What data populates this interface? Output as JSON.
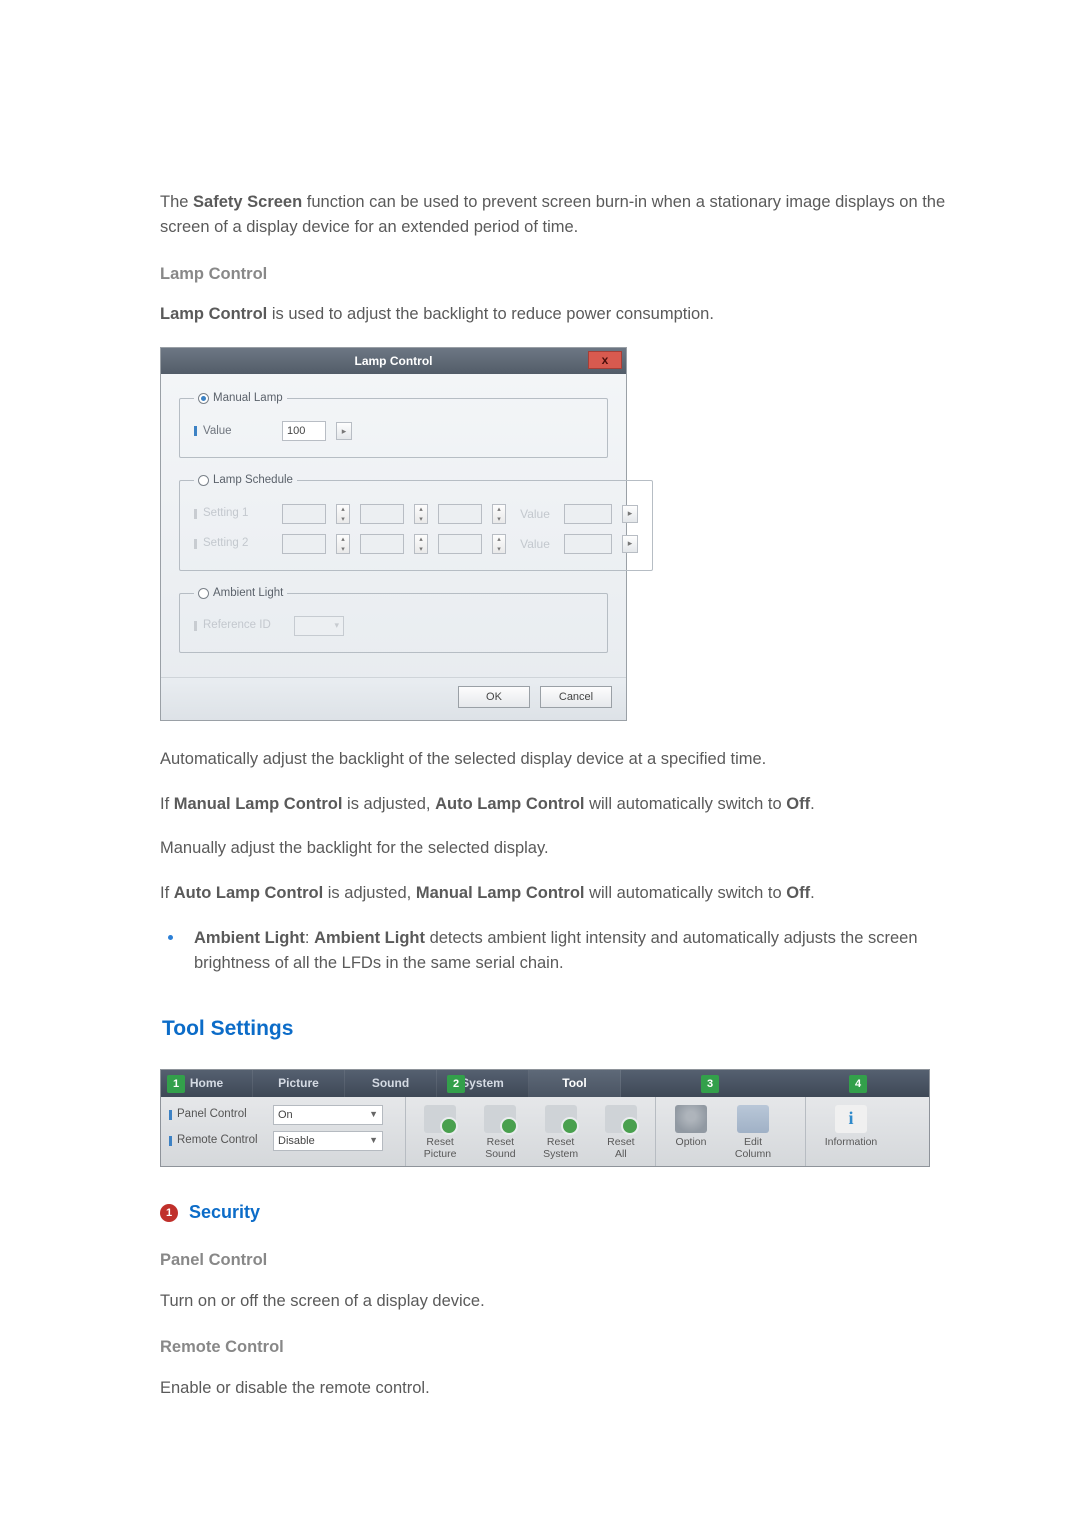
{
  "intro_before1": "The ",
  "intro_strong1": "Safety Screen",
  "intro_after1": " function can be used to prevent screen burn-in when a stationary image displays on the screen of a display device for an extended period of time.",
  "lamp_control_heading": "Lamp Control",
  "lamp_control_desc_strong": "Lamp Control",
  "lamp_control_desc_after": " is used to adjust the backlight to reduce power consumption.",
  "dialog": {
    "title": "Lamp Control",
    "close": "x",
    "manual_lamp": {
      "legend": "Manual Lamp",
      "value_label": "Value",
      "value": "100"
    },
    "lamp_schedule": {
      "legend": "Lamp Schedule",
      "rows": [
        {
          "label": "Setting 1",
          "value_label": "Value"
        },
        {
          "label": "Setting 2",
          "value_label": "Value"
        }
      ]
    },
    "ambient": {
      "legend": "Ambient Light",
      "ref_label": "Reference ID"
    },
    "ok": "OK",
    "cancel": "Cancel"
  },
  "p_auto_adjust": "Automatically adjust the backlight of the selected display device at a specified time.",
  "p2_if": "If ",
  "p2_s1": "Manual Lamp Control",
  "p2_mid": " is adjusted, ",
  "p2_s2": "Auto Lamp Control",
  "p2_end": " will automatically switch to ",
  "p2_off": "Off",
  "p_manual_adjust": "Manually adjust the backlight for the selected display.",
  "p4_if": "If ",
  "p4_s1": "Auto Lamp Control",
  "p4_mid": " is adjusted, ",
  "p4_s2": "Manual Lamp Control",
  "p4_end": " will automatically switch to ",
  "p4_off": "Off",
  "bullet_s1": "Ambient Light",
  "bullet_col": ": ",
  "bullet_s2": "Ambient Light",
  "bullet_rest": " detects ambient light intensity and automatically adjusts the screen brightness of all the LFDs in the same serial chain.",
  "tool_settings_title": "Tool Settings",
  "ribbon": {
    "tabs": {
      "home": "Home",
      "picture": "Picture",
      "sound": "Sound",
      "system": "System",
      "tool": "Tool"
    },
    "tags": {
      "t1": "1",
      "t2": "2",
      "t3": "3",
      "t4": "4"
    },
    "sec1": {
      "panel_label": "Panel Control",
      "panel_value": "On",
      "remote_label": "Remote Control",
      "remote_value": "Disable"
    },
    "sec2": {
      "rp1": "Reset",
      "rp2": "Picture",
      "rs1": "Reset",
      "rs2": "Sound",
      "rsy1": "Reset",
      "rsy2": "System",
      "ra1": "Reset",
      "ra2": "All"
    },
    "sec3": {
      "opt": "Option",
      "ec1": "Edit",
      "ec2": "Column"
    },
    "sec4": {
      "info": "Information"
    }
  },
  "security": {
    "badge": "1",
    "title": "Security"
  },
  "panel_control_heading": "Panel Control",
  "panel_control_desc": "Turn on or off the screen of a display device.",
  "remote_control_heading": "Remote Control",
  "remote_control_desc": "Enable or disable the remote control."
}
